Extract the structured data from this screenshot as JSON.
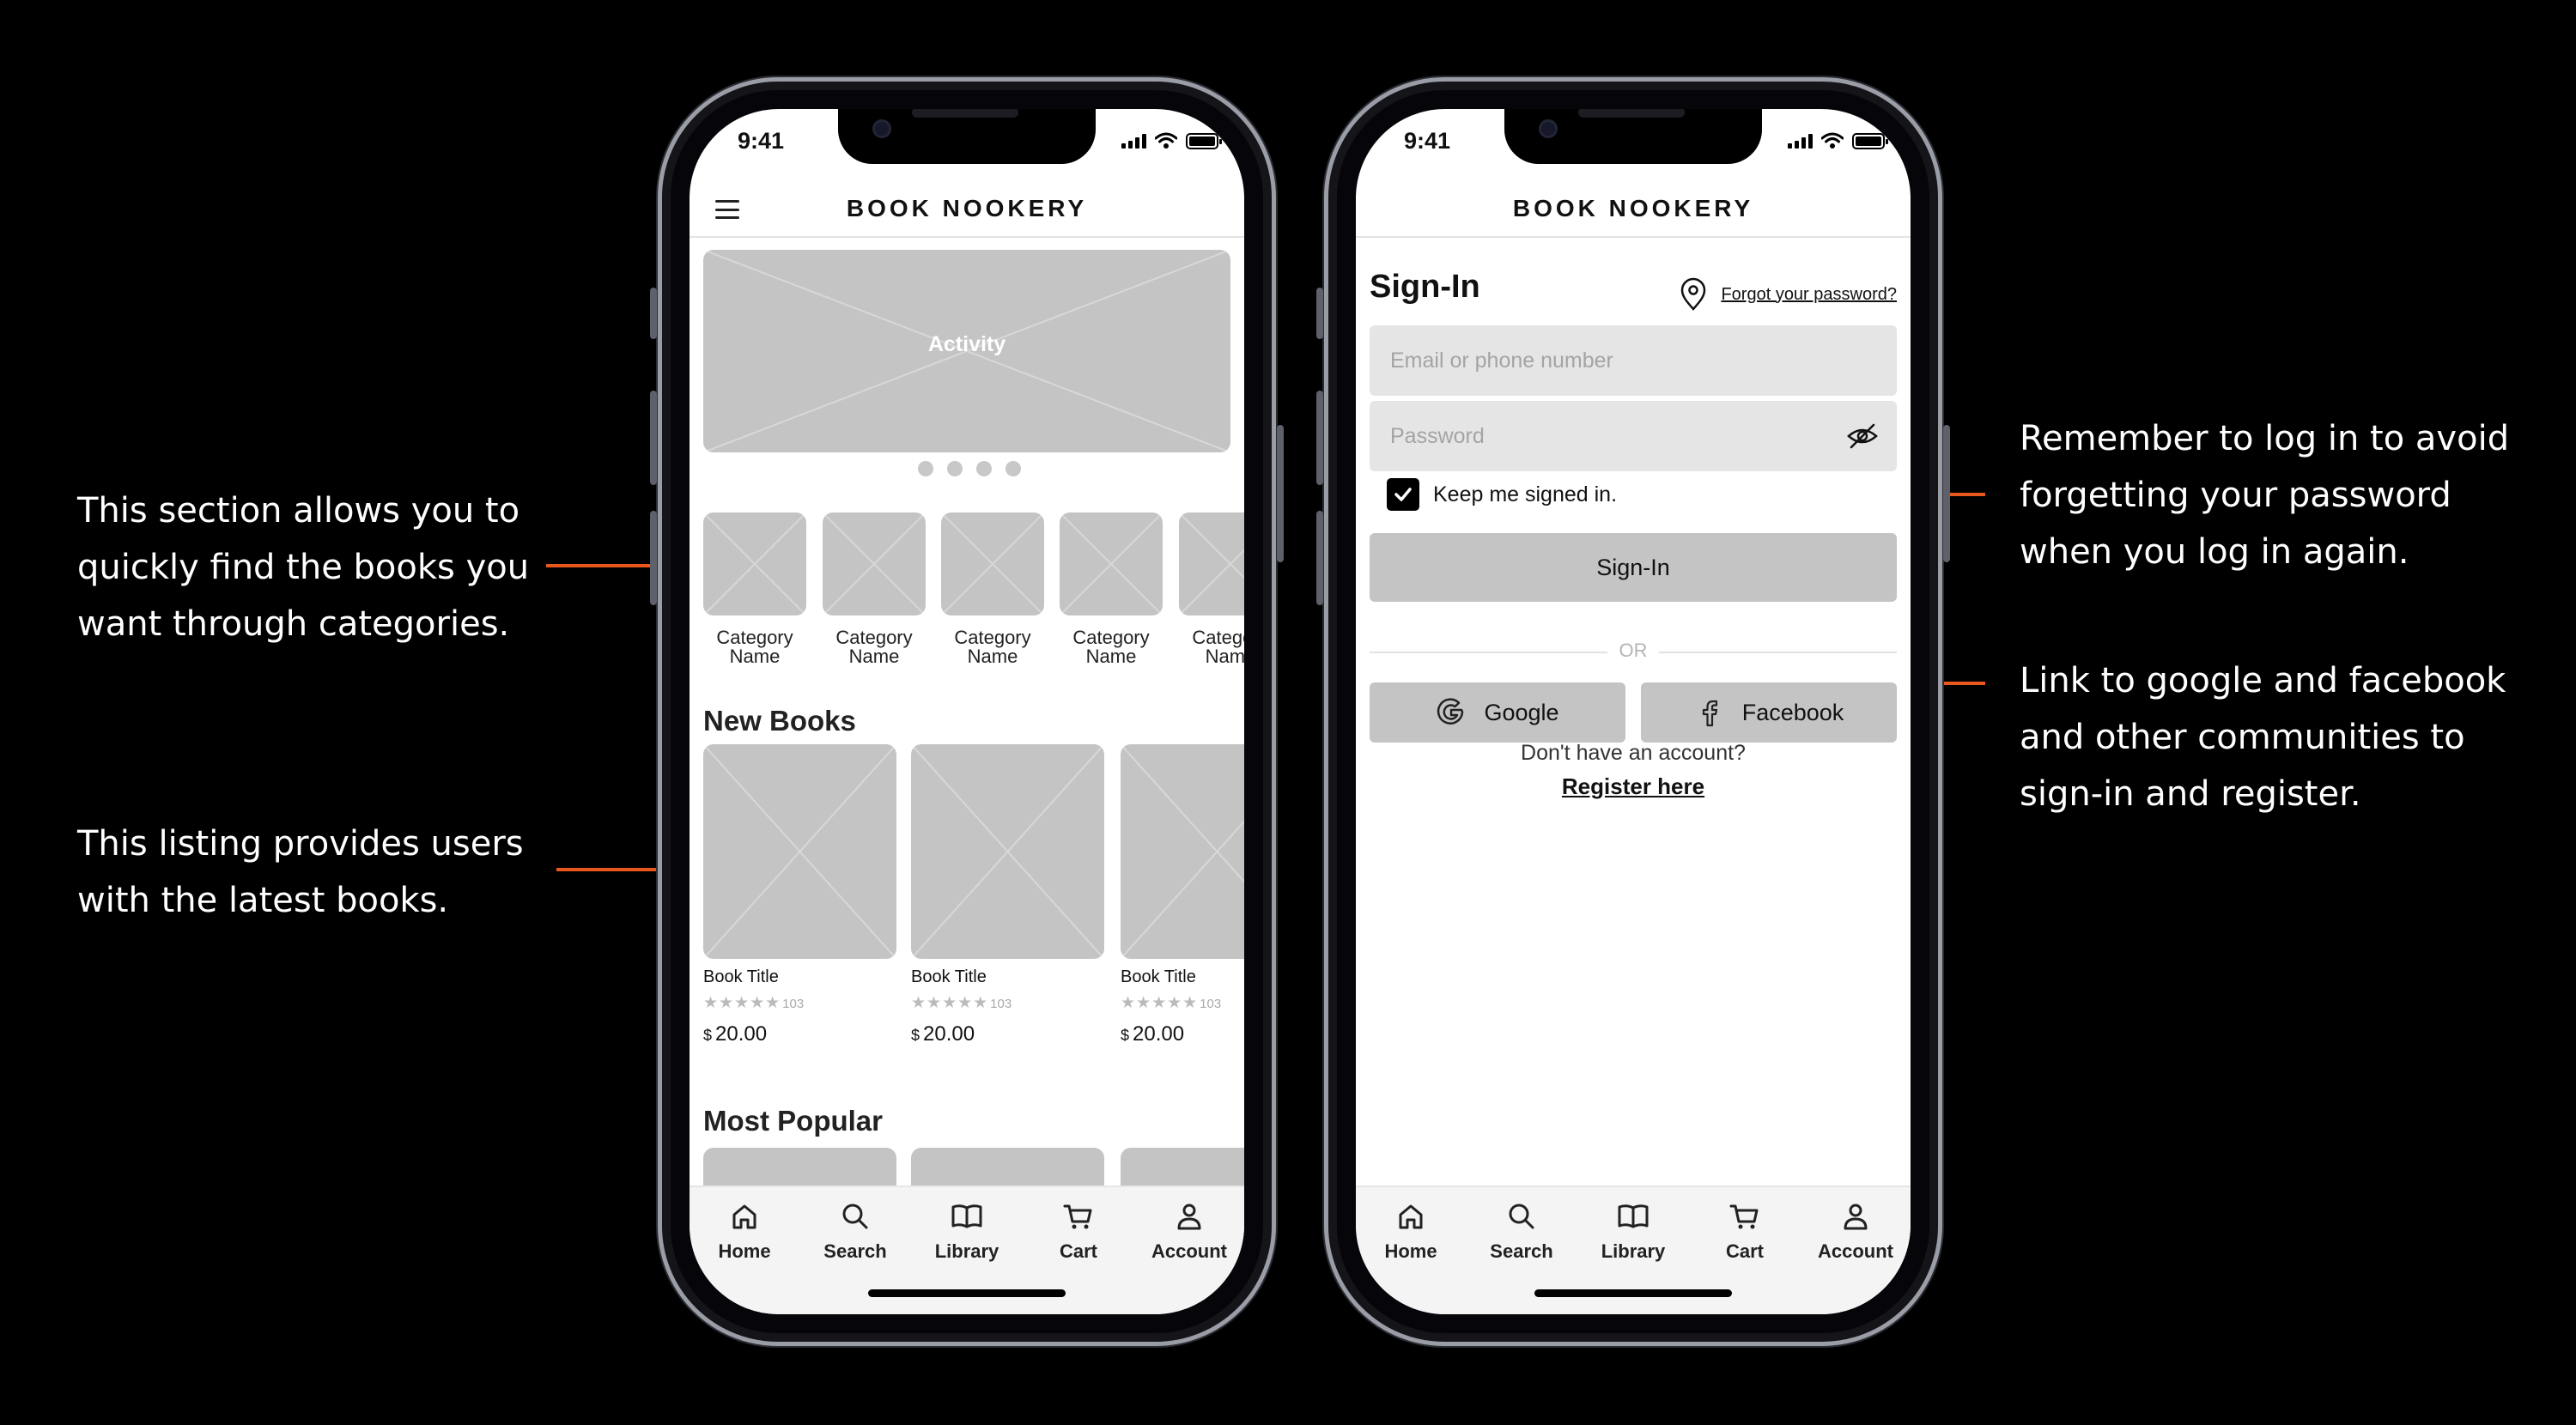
{
  "annotations": {
    "categories": [
      "This section allows you to",
      "quickly find the books you",
      "want through categories."
    ],
    "new_books": [
      "This listing provides users",
      "with the latest books."
    ],
    "keep_signed": [
      "Remember to log in to avoid",
      "forgetting your password",
      "when you log in again."
    ],
    "social": [
      "Link to google and facebook",
      "and other communities to",
      "sign-in and register."
    ]
  },
  "accent_color": "#e8571b",
  "status_bar": {
    "time": "9:41"
  },
  "app": {
    "title": "BOOK NOOKERY"
  },
  "home": {
    "banner_label": "Activity",
    "carousel_pages": 4,
    "categories": [
      {
        "line1": "Category",
        "line2": "Name"
      },
      {
        "line1": "Category",
        "line2": "Name"
      },
      {
        "line1": "Category",
        "line2": "Name"
      },
      {
        "line1": "Category",
        "line2": "Name"
      },
      {
        "line1": "Category",
        "line2": "Name"
      }
    ],
    "new_books_title": "New Books",
    "books": [
      {
        "title": "Book Title",
        "rating_count": "103",
        "currency": "$",
        "price": "20.00"
      },
      {
        "title": "Book Title",
        "rating_count": "103",
        "currency": "$",
        "price": "20.00"
      },
      {
        "title": "Book Title",
        "rating_count": "103",
        "currency": "$",
        "price": "20.00"
      }
    ],
    "most_popular_title": "Most Popular"
  },
  "signin": {
    "title": "Sign-In",
    "forgot_password": "Forgot your password?",
    "email_placeholder": "Email or phone number",
    "password_placeholder": "Password",
    "keep_signed_in": "Keep me signed in.",
    "keep_signed_in_checked": true,
    "signin_button": "Sign-In",
    "or_label": "OR",
    "google_label": "Google",
    "facebook_label": "Facebook",
    "no_account": "Don't have an account?",
    "register": "Register here"
  },
  "tabbar": [
    {
      "label": "Home",
      "icon": "home-icon"
    },
    {
      "label": "Search",
      "icon": "search-icon"
    },
    {
      "label": "Library",
      "icon": "book-icon"
    },
    {
      "label": "Cart",
      "icon": "cart-icon"
    },
    {
      "label": "Account",
      "icon": "account-icon"
    }
  ]
}
